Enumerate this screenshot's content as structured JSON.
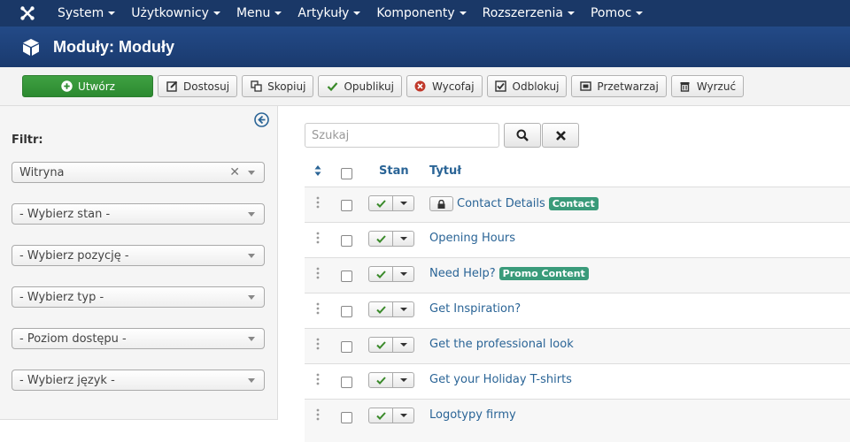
{
  "topnav": {
    "items": [
      {
        "label": "System"
      },
      {
        "label": "Użytkownicy"
      },
      {
        "label": "Menu"
      },
      {
        "label": "Artykuły"
      },
      {
        "label": "Komponenty"
      },
      {
        "label": "Rozszerzenia"
      },
      {
        "label": "Pomoc"
      }
    ]
  },
  "header": {
    "title": "Moduły: Moduły",
    "icon": "cube-icon"
  },
  "toolbar": {
    "new": "Utwórz",
    "edit": "Dostosuj",
    "copy": "Skopiuj",
    "publish": "Opublikuj",
    "unpublish": "Wycofaj",
    "checkin": "Odblokuj",
    "batch": "Przetwarzaj",
    "trash": "Wyrzuć"
  },
  "sidebar": {
    "filter_label": "Filtr:",
    "filters": [
      {
        "value": "Witryna",
        "clearable": true
      },
      {
        "value": "- Wybierz stan -"
      },
      {
        "value": "- Wybierz pozycję -"
      },
      {
        "value": "- Wybierz typ -"
      },
      {
        "value": "- Poziom dostępu -"
      },
      {
        "value": "- Wybierz język -"
      }
    ]
  },
  "search": {
    "placeholder": "Szukaj"
  },
  "table": {
    "headers": {
      "status": "Stan",
      "title": "Tytuł"
    },
    "rows": [
      {
        "title": "Contact Details",
        "locked": true,
        "badge": "Contact"
      },
      {
        "title": "Opening Hours"
      },
      {
        "title": "Need Help?",
        "badge": "Promo Content"
      },
      {
        "title": "Get Inspiration?"
      },
      {
        "title": "Get the professional look"
      },
      {
        "title": "Get your Holiday T-shirts"
      },
      {
        "title": "Logotypy firmy"
      }
    ]
  },
  "colors": {
    "nav_bg": "#1a3867",
    "header_bg": "#234a87",
    "primary_green": "#3fa142",
    "link_blue": "#2a6496",
    "badge_teal": "#3a9b7a"
  }
}
